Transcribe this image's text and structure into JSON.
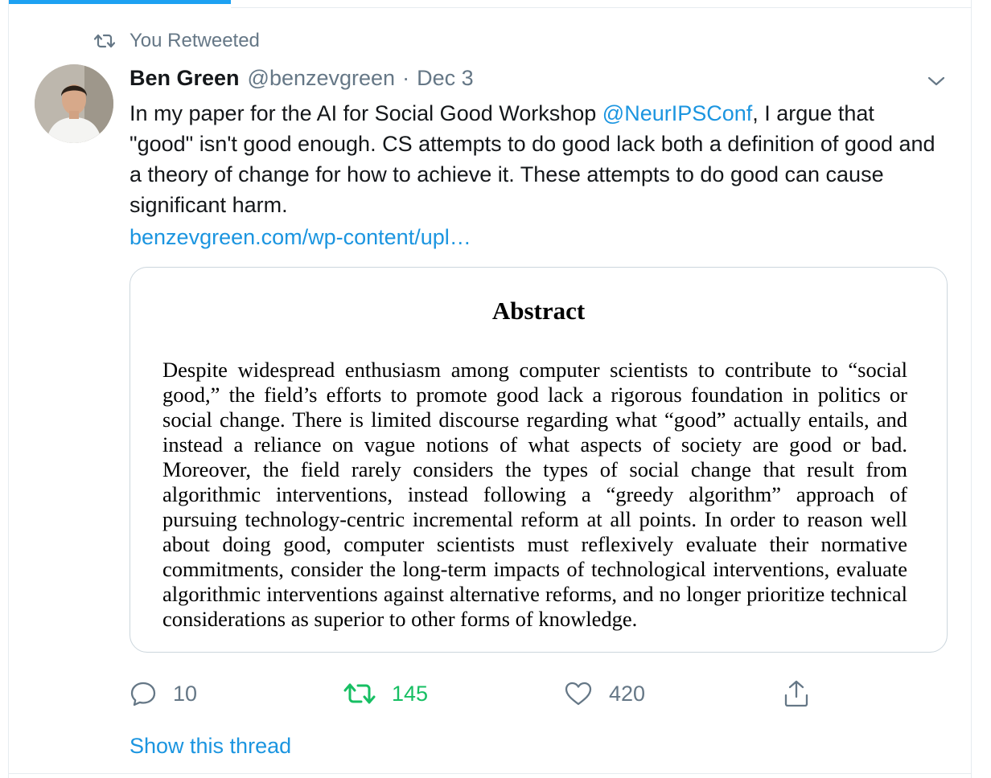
{
  "social_context": {
    "label": "You Retweeted"
  },
  "tweet": {
    "author_name": "Ben Green",
    "author_handle": "@benzevgreen",
    "separator": "·",
    "date": "Dec 3",
    "text_before_mention": "In my paper for the AI for Social Good Workshop ",
    "mention": "@NeurIPSConf",
    "text_after_mention": ", I argue that \"good\" isn't good enough. CS attempts to do good lack both a definition of good and a theory of change for how to achieve it. These attempts to do good can cause significant harm.",
    "link": "benzevgreen.com/wp-content/upl…"
  },
  "card": {
    "title": "Abstract",
    "body": "Despite widespread enthusiasm among computer scientists to contribute to “social good,” the field’s efforts to promote good lack a rigorous foundation in politics or social change.  There is limited discourse regarding what “good” actually entails, and instead a reliance on vague notions of what aspects of society are good or bad.  Moreover, the field rarely considers the types of social change that result from algorithmic interventions, instead following a “greedy algorithm” approach of pursuing technology-centric incremental reform at all points. In order to reason well about doing good, computer scientists must reflexively evaluate their normative commitments, consider the long-term impacts of technological interventions, evaluate algorithmic interventions against alternative reforms, and no longer prioritize technical considerations as superior to other forms of knowledge."
  },
  "actions": {
    "reply_count": "10",
    "retweet_count": "145",
    "like_count": "420"
  },
  "show_thread": "Show this thread",
  "colors": {
    "accent": "#1b95e0",
    "retweeted": "#17bf63",
    "muted": "#657786",
    "text": "#14171a",
    "border": "#ccd6dd"
  },
  "icons": [
    "retweet-icon",
    "chevron-down-icon",
    "reply-icon",
    "retweet-icon",
    "heart-icon",
    "share-icon"
  ]
}
